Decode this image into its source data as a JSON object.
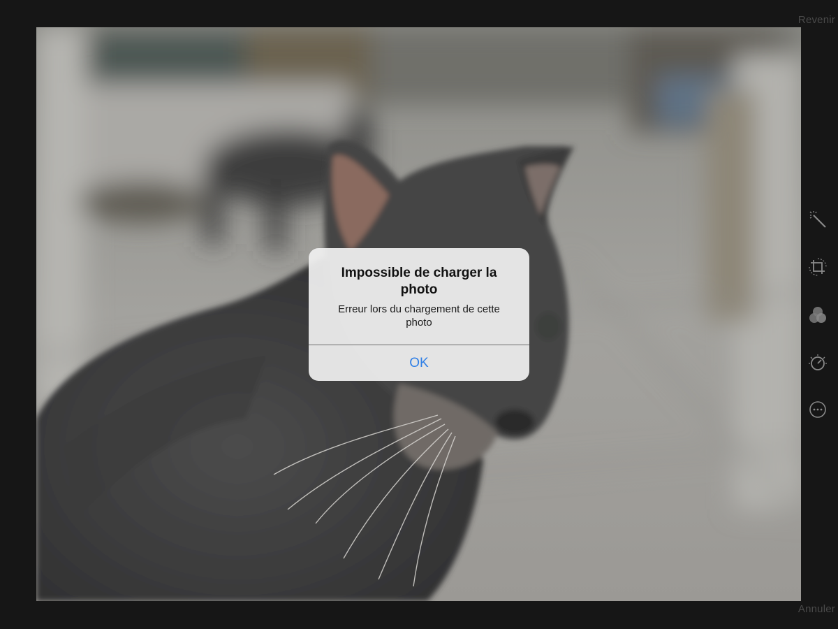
{
  "toolbar": {
    "revert_label": "Revenir",
    "cancel_label": "Annuler"
  },
  "tools": [
    {
      "name": "auto-enhance",
      "icon": "magic-wand-icon"
    },
    {
      "name": "crop",
      "icon": "crop-rotate-icon"
    },
    {
      "name": "filters",
      "icon": "filters-icon"
    },
    {
      "name": "adjust",
      "icon": "adjust-dial-icon"
    },
    {
      "name": "more",
      "icon": "more-ellipsis-icon"
    }
  ],
  "alert": {
    "title": "Impossible de charger la photo",
    "message": "Erreur lors du chargement de cette photo",
    "ok_label": "OK"
  },
  "colors": {
    "background": "#161616",
    "accent": "#2f7fe6",
    "tool_icon": "#8a8a8a",
    "muted_text": "#4a4a4a"
  }
}
